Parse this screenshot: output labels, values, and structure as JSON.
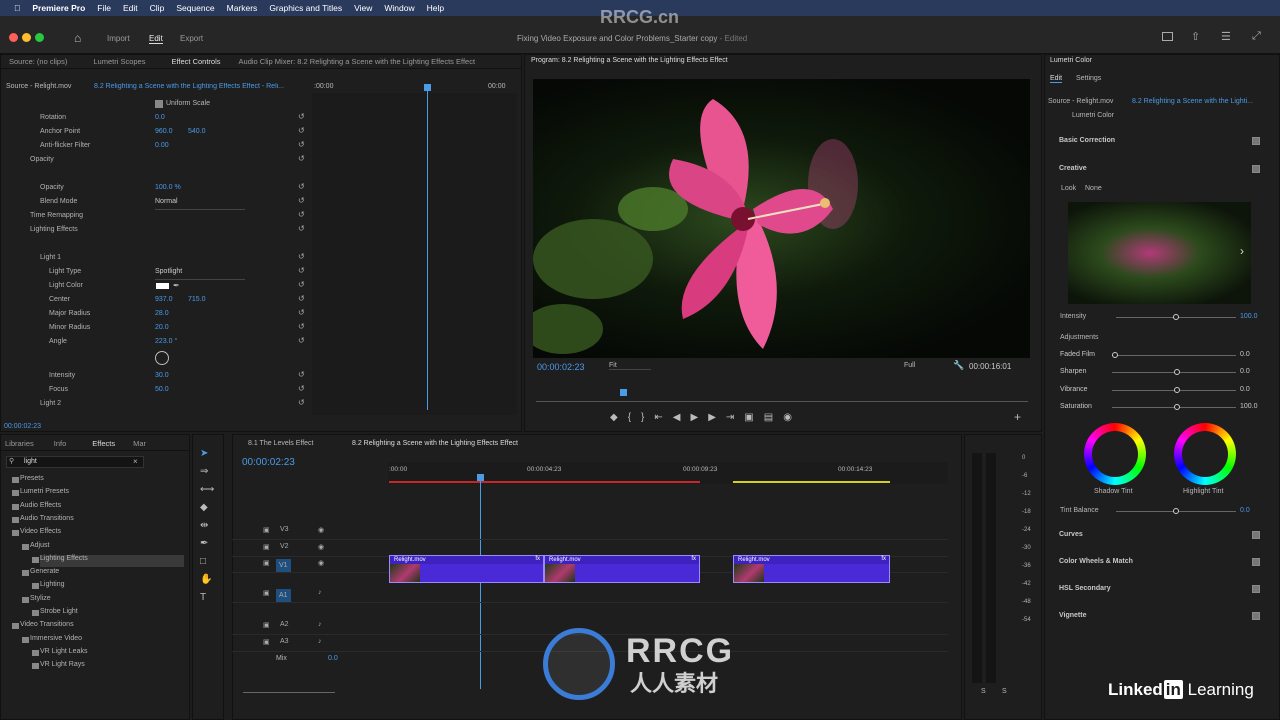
{
  "menubar": {
    "app": "Premiere Pro",
    "items": [
      "File",
      "Edit",
      "Clip",
      "Sequence",
      "Markers",
      "Graphics and Titles",
      "View",
      "Window",
      "Help"
    ]
  },
  "titlebar": {
    "tabs": {
      "import": "Import",
      "edit": "Edit",
      "export": "Export"
    },
    "document": "Fixing Video Exposure and Color Problems_Starter copy",
    "status": "- Edited"
  },
  "watermark": {
    "top": "RRCG.cn",
    "brand": "RRCG",
    "sub": "人人素材"
  },
  "source_panel": {
    "tabs": [
      "Source: (no clips)",
      "Lumetri Scopes",
      "Effect Controls",
      "Audio Clip Mixer: 8.2 Relighting a Scene with the Lighting Effects Effect"
    ],
    "source_label": "Source - Relight.mov",
    "sequence_label": "8.2 Relighting a Scene with the Lighting Effects Effect - Reli...",
    "timecode_start": ":00:00",
    "timecode_end": "00:00",
    "uniform_scale": "Uniform Scale",
    "rows": [
      {
        "label": "Rotation",
        "v1": "0.0",
        "v2": ""
      },
      {
        "label": "Anchor Point",
        "v1": "960.0",
        "v2": "540.0"
      },
      {
        "label": "Anti-flicker Filter",
        "v1": "0.00",
        "v2": ""
      },
      {
        "label": "Opacity",
        "v1": "",
        "v2": ""
      },
      {
        "label": "Opacity",
        "v1": "100.0 %",
        "v2": ""
      },
      {
        "label": "Blend Mode",
        "v1": "Normal",
        "v2": ""
      },
      {
        "label": "Time Remapping",
        "v1": "",
        "v2": ""
      },
      {
        "label": "Lighting Effects",
        "v1": "",
        "v2": ""
      },
      {
        "label": "Light 1",
        "v1": "",
        "v2": ""
      },
      {
        "label": "Light Type",
        "v1": "Spotlight",
        "v2": ""
      },
      {
        "label": "Light Color",
        "v1": "",
        "v2": ""
      },
      {
        "label": "Center",
        "v1": "937.0",
        "v2": "715.0"
      },
      {
        "label": "Major Radius",
        "v1": "28.0",
        "v2": ""
      },
      {
        "label": "Minor Radius",
        "v1": "20.0",
        "v2": ""
      },
      {
        "label": "Angle",
        "v1": "223.0 °",
        "v2": ""
      },
      {
        "label": "Intensity",
        "v1": "30.0",
        "v2": ""
      },
      {
        "label": "Focus",
        "v1": "50.0",
        "v2": ""
      },
      {
        "label": "Light 2",
        "v1": "",
        "v2": ""
      }
    ],
    "current_time": "00:00:02:23"
  },
  "program": {
    "title": "Program: 8.2 Relighting a Scene with the Lighting Effects Effect",
    "timecode": "00:00:02:23",
    "fit": "Fit",
    "quality": "Full",
    "duration": "00:00:16:01"
  },
  "project_panel": {
    "tabs": [
      "Libraries",
      "Info",
      "Effects",
      "Mar"
    ],
    "search": "light",
    "tree": [
      {
        "label": "Presets",
        "indent": 0
      },
      {
        "label": "Lumetri Presets",
        "indent": 0
      },
      {
        "label": "Audio Effects",
        "indent": 0
      },
      {
        "label": "Audio Transitions",
        "indent": 0
      },
      {
        "label": "Video Effects",
        "indent": 0
      },
      {
        "label": "Adjust",
        "indent": 1
      },
      {
        "label": "Lighting Effects",
        "indent": 2
      },
      {
        "label": "Generate",
        "indent": 1
      },
      {
        "label": "Lighting",
        "indent": 2
      },
      {
        "label": "Stylize",
        "indent": 1
      },
      {
        "label": "Strobe Light",
        "indent": 2
      },
      {
        "label": "Video Transitions",
        "indent": 0
      },
      {
        "label": "Immersive Video",
        "indent": 1
      },
      {
        "label": "VR Light Leaks",
        "indent": 2
      },
      {
        "label": "VR Light Rays",
        "indent": 2
      }
    ]
  },
  "timeline": {
    "tabs": [
      "8.1 The Levels Effect",
      "8.2 Relighting a Scene with the Lighting Effects Effect"
    ],
    "timecode": "00:00:02:23",
    "ruler": [
      ":00:00",
      "00:00:04:23",
      "00:00:09:23",
      "00:00:14:23"
    ],
    "tracks": [
      "V3",
      "V2",
      "V1",
      "A1",
      "A2",
      "A3"
    ],
    "mix_label": "Mix",
    "mix_value": "0.0",
    "clips": [
      "Relight.mov",
      "Relight.mov",
      "Relight.mov"
    ],
    "meter_labels": [
      "0",
      "-6",
      "-12",
      "-18",
      "-24",
      "-30",
      "-36",
      "-42",
      "-48",
      "-54"
    ],
    "meter_solo": "S"
  },
  "lumetri": {
    "title": "Lumetri Color",
    "tabs": [
      "Edit",
      "Settings"
    ],
    "source": "Source - Relight.mov",
    "sequence": "8.2 Relighting a Scene with the Lighti...",
    "effect": "Lumetri Color",
    "sections": [
      "Basic Correction",
      "Creative",
      "Curves",
      "Color Wheels & Match",
      "HSL Secondary",
      "Vignette"
    ],
    "look_label": "Look",
    "look_value": "None",
    "intensity_label": "Intensity",
    "intensity_value": "100.0",
    "adjustments": "Adjustments",
    "params": [
      {
        "label": "Faded Film",
        "value": "0.0"
      },
      {
        "label": "Sharpen",
        "value": "0.0"
      },
      {
        "label": "Vibrance",
        "value": "0.0"
      },
      {
        "label": "Saturation",
        "value": "100.0"
      }
    ],
    "shadow_tint": "Shadow Tint",
    "highlight_tint": "Highlight Tint",
    "tint_balance": "Tint Balance",
    "tint_balance_value": "0.0"
  },
  "linkedin": {
    "brand": "Linked",
    "in": "in",
    "learning": "Learning"
  }
}
